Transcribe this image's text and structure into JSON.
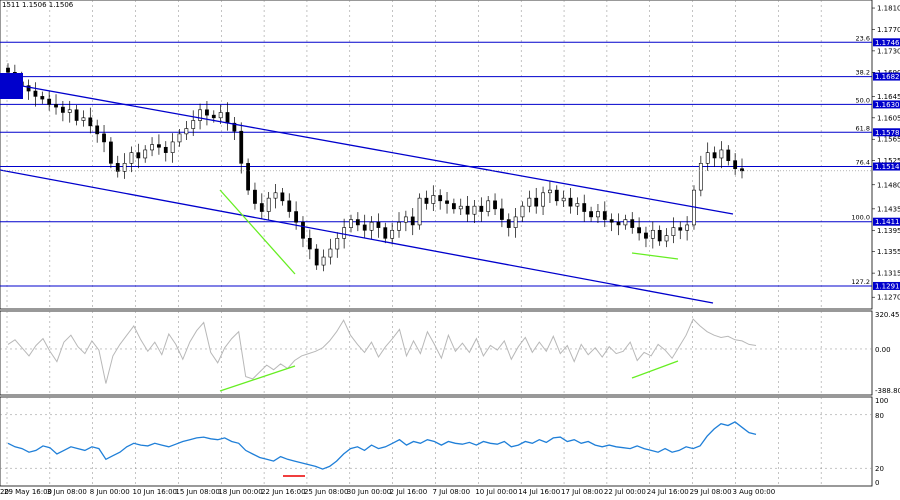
{
  "header": {
    "symbol_info": "1511 1.1506 1.1506"
  },
  "chart_data": {
    "type": "candlestick",
    "x_labels": [
      "29 May 16:00",
      "3 Jun 08:00",
      "8 Jun 00:00",
      "10 Jun 16:00",
      "15 Jun 08:00",
      "18 Jun 00:00",
      "22 Jun 16:00",
      "25 Jun 08:00",
      "30 Jun 00:00",
      "2 Jul 16:00",
      "7 Jul 08:00",
      "10 Jul 00:00",
      "14 Jul 16:00",
      "17 Jul 08:00",
      "22 Jul 00:00",
      "24 Jul 16:00",
      "29 Jul 08:00",
      "3 Aug 00:00"
    ],
    "x_first_label": "20",
    "price_ticks": [
      "1.1810",
      "1.1770",
      "1.1730",
      "1.1690",
      "1.1645",
      "1.1605",
      "1.1565",
      "1.1525",
      "1.1480",
      "1.1435",
      "1.1395",
      "1.1355",
      "1.1315",
      "1.1270"
    ],
    "price_range": [
      1.1248,
      1.1825
    ],
    "fib_levels": [
      {
        "ratio": "23.6",
        "price": "1.1746",
        "color": "#0000cc"
      },
      {
        "ratio": "38.2",
        "price": "1.1682",
        "color": "#0000cc"
      },
      {
        "ratio": "50.0",
        "price": "1.1630",
        "color": "#0000cc"
      },
      {
        "ratio": "61.8",
        "price": "1.1578",
        "color": "#0000cc"
      },
      {
        "ratio": "76.4",
        "price": "1.1514",
        "color": "#0000cc"
      },
      {
        "ratio": "100.0",
        "price": "1.1411",
        "color": "#0000cc"
      },
      {
        "ratio": "127.2",
        "price": "1.1291",
        "color": "#0000cc"
      }
    ],
    "current_price": "1.1506",
    "closes": [
      1.169,
      1.1672,
      1.1665,
      1.1655,
      1.1645,
      1.164,
      1.163,
      1.1625,
      1.1615,
      1.162,
      1.16,
      1.1605,
      1.159,
      1.1575,
      1.156,
      1.152,
      1.1505,
      1.152,
      1.154,
      1.153,
      1.1545,
      1.1555,
      1.155,
      1.154,
      1.156,
      1.1575,
      1.1585,
      1.16,
      1.162,
      1.161,
      1.1605,
      1.1615,
      1.1595,
      1.158,
      1.152,
      1.147,
      1.1445,
      1.143,
      1.1455,
      1.1465,
      1.145,
      1.143,
      1.141,
      1.138,
      1.136,
      1.133,
      1.1345,
      1.136,
      1.138,
      1.14,
      1.1415,
      1.1405,
      1.1395,
      1.141,
      1.14,
      1.138,
      1.1395,
      1.141,
      1.142,
      1.1405,
      1.1455,
      1.1445,
      1.146,
      1.145,
      1.1445,
      1.1435,
      1.144,
      1.1425,
      1.144,
      1.143,
      1.145,
      1.1435,
      1.1415,
      1.14,
      1.142,
      1.144,
      1.1455,
      1.144,
      1.1465,
      1.147,
      1.145,
      1.1455,
      1.144,
      1.1445,
      1.143,
      1.142,
      1.143,
      1.1415,
      1.141,
      1.1405,
      1.1415,
      1.14,
      1.139,
      1.138,
      1.1395,
      1.1375,
      1.1385,
      1.14,
      1.1395,
      1.1405,
      1.147,
      1.152,
      1.154,
      1.153,
      1.1545,
      1.1525,
      1.151,
      1.1506
    ],
    "cci": {
      "label_top": "320.4558",
      "label_mid": "0.00",
      "label_bot": "-388.802",
      "range": [
        -400,
        330
      ],
      "values": [
        40,
        80,
        10,
        -60,
        30,
        90,
        -20,
        -110,
        60,
        120,
        20,
        -40,
        70,
        -10,
        -300,
        -60,
        40,
        120,
        200,
        80,
        -20,
        60,
        -50,
        130,
        40,
        -90,
        60,
        160,
        230,
        -30,
        -120,
        10,
        90,
        150,
        -240,
        -260,
        -200,
        -140,
        -180,
        -130,
        -170,
        -100,
        -60,
        -40,
        -20,
        10,
        70,
        150,
        250,
        120,
        40,
        -30,
        60,
        -70,
        20,
        90,
        170,
        -60,
        70,
        -40,
        150,
        40,
        -80,
        120,
        -20,
        50,
        -30,
        90,
        -60,
        30,
        -10,
        70,
        -90,
        20,
        100,
        -30,
        60,
        -20,
        110,
        -40,
        30,
        -110,
        40,
        -50,
        10,
        -70,
        20,
        -40,
        -20,
        60,
        -100,
        -30,
        -60,
        40,
        -10,
        -80,
        20,
        120,
        260,
        200,
        150,
        120,
        100,
        110,
        80,
        70,
        40,
        30
      ]
    },
    "rsi": {
      "label_top": "100",
      "label_mid": "80",
      "label_low": "20",
      "label_bot": "0",
      "range": [
        0,
        100
      ],
      "values": [
        48,
        44,
        42,
        38,
        40,
        45,
        43,
        36,
        40,
        44,
        42,
        40,
        44,
        42,
        30,
        34,
        38,
        44,
        48,
        46,
        45,
        48,
        46,
        44,
        47,
        50,
        52,
        54,
        55,
        53,
        52,
        54,
        50,
        48,
        40,
        36,
        32,
        30,
        28,
        33,
        30,
        28,
        26,
        24,
        22,
        19,
        22,
        28,
        36,
        42,
        44,
        40,
        46,
        42,
        44,
        48,
        52,
        46,
        50,
        48,
        52,
        50,
        46,
        50,
        48,
        47,
        49,
        46,
        50,
        48,
        47,
        50,
        44,
        46,
        50,
        48,
        52,
        49,
        54,
        55,
        50,
        52,
        48,
        50,
        46,
        44,
        46,
        44,
        43,
        42,
        45,
        42,
        40,
        38,
        42,
        38,
        40,
        44,
        42,
        45,
        56,
        64,
        70,
        68,
        72,
        66,
        60,
        58
      ]
    }
  },
  "colors": {
    "level": "#0000cc",
    "channel": "#0000cc",
    "divergence": "#66ee22",
    "rsi": "#1f7fd8",
    "cci": "#b8b8b8",
    "highlight": "#ee2222"
  }
}
